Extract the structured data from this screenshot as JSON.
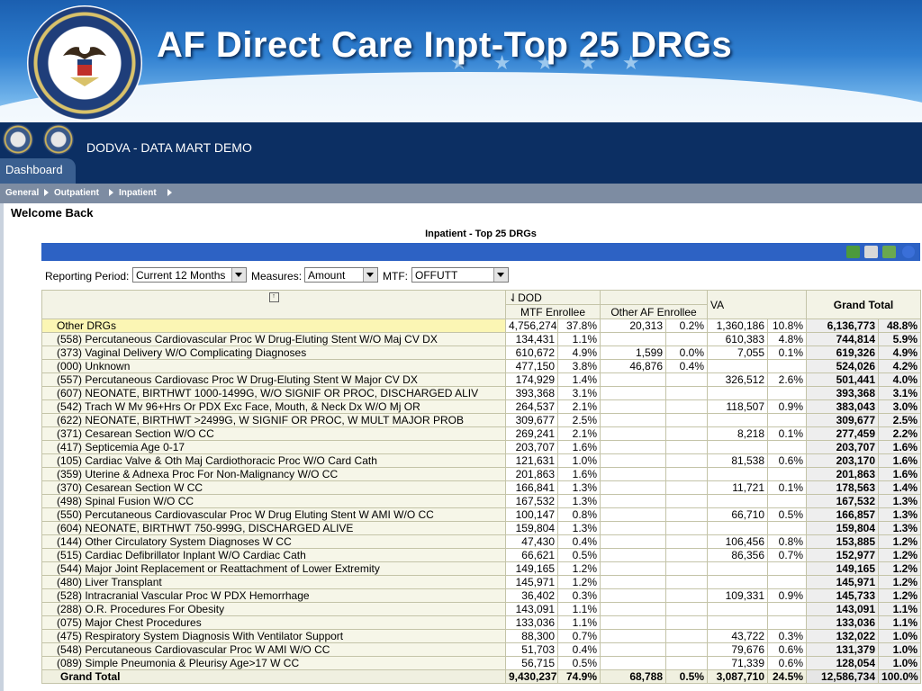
{
  "page_title": "AF Direct Care Inpt-Top 25 DRGs",
  "app": {
    "name": "DODVA - DATA MART DEMO",
    "tab": "Dashboard"
  },
  "subnav": [
    "General",
    "Outpatient",
    "Inpatient"
  ],
  "welcome": "Welcome Back",
  "report": {
    "title": "Inpatient - Top 25 DRGs",
    "params": {
      "period_label": "Reporting Period:",
      "period_value": "Current 12 Months",
      "measures_label": "Measures:",
      "measures_value": "Amount",
      "mtf_label": "MTF:",
      "mtf_value": "OFFUTT"
    },
    "headers": {
      "dod": "DOD",
      "mtf": "MTF Enrollee",
      "other_af": "Other AF Enrollee",
      "va": "VA",
      "grand_total": "Grand Total"
    },
    "rows": [
      [
        "Other DRGs",
        "4,756,274",
        "37.8%",
        "20,313",
        "0.2%",
        "1,360,186",
        "10.8%",
        "6,136,773",
        "48.8%"
      ],
      [
        "(558) Percutaneous Cardiovascular Proc W Drug-Eluting Stent W/O Maj CV DX",
        "134,431",
        "1.1%",
        "",
        "",
        "610,383",
        "4.8%",
        "744,814",
        "5.9%"
      ],
      [
        "(373) Vaginal Delivery W/O Complicating Diagnoses",
        "610,672",
        "4.9%",
        "1,599",
        "0.0%",
        "7,055",
        "0.1%",
        "619,326",
        "4.9%"
      ],
      [
        "(000) Unknown",
        "477,150",
        "3.8%",
        "46,876",
        "0.4%",
        "",
        "",
        "524,026",
        "4.2%"
      ],
      [
        "(557) Percutaneous Cardiovasc Proc W Drug-Eluting Stent W Major CV DX",
        "174,929",
        "1.4%",
        "",
        "",
        "326,512",
        "2.6%",
        "501,441",
        "4.0%"
      ],
      [
        "(607) NEONATE, BIRTHWT 1000-1499G, W/O SIGNIF OR PROC, DISCHARGED ALIV",
        "393,368",
        "3.1%",
        "",
        "",
        "",
        "",
        "393,368",
        "3.1%"
      ],
      [
        "(542) Trach W Mv 96+Hrs Or PDX Exc Face, Mouth, & Neck Dx W/O Mj OR",
        "264,537",
        "2.1%",
        "",
        "",
        "118,507",
        "0.9%",
        "383,043",
        "3.0%"
      ],
      [
        "(622) NEONATE, BIRTHWT >2499G, W SIGNIF OR PROC, W MULT MAJOR PROB",
        "309,677",
        "2.5%",
        "",
        "",
        "",
        "",
        "309,677",
        "2.5%"
      ],
      [
        "(371) Cesarean Section W/O CC",
        "269,241",
        "2.1%",
        "",
        "",
        "8,218",
        "0.1%",
        "277,459",
        "2.2%"
      ],
      [
        "(417) Septicemia Age 0-17",
        "203,707",
        "1.6%",
        "",
        "",
        "",
        "",
        "203,707",
        "1.6%"
      ],
      [
        "(105) Cardiac Valve & Oth Maj Cardiothoracic Proc W/O Card Cath",
        "121,631",
        "1.0%",
        "",
        "",
        "81,538",
        "0.6%",
        "203,170",
        "1.6%"
      ],
      [
        "(359) Uterine & Adnexa Proc For Non-Malignancy W/O CC",
        "201,863",
        "1.6%",
        "",
        "",
        "",
        "",
        "201,863",
        "1.6%"
      ],
      [
        "(370) Cesarean Section W CC",
        "166,841",
        "1.3%",
        "",
        "",
        "11,721",
        "0.1%",
        "178,563",
        "1.4%"
      ],
      [
        "(498) Spinal Fusion W/O CC",
        "167,532",
        "1.3%",
        "",
        "",
        "",
        "",
        "167,532",
        "1.3%"
      ],
      [
        "(550) Percutaneous Cardiovascular Proc W Drug Eluting Stent W AMI W/O CC",
        "100,147",
        "0.8%",
        "",
        "",
        "66,710",
        "0.5%",
        "166,857",
        "1.3%"
      ],
      [
        "(604) NEONATE, BIRTHWT 750-999G, DISCHARGED ALIVE",
        "159,804",
        "1.3%",
        "",
        "",
        "",
        "",
        "159,804",
        "1.3%"
      ],
      [
        "(144) Other Circulatory System Diagnoses W CC",
        "47,430",
        "0.4%",
        "",
        "",
        "106,456",
        "0.8%",
        "153,885",
        "1.2%"
      ],
      [
        "(515) Cardiac Defibrillator Inplant W/O Cardiac Cath",
        "66,621",
        "0.5%",
        "",
        "",
        "86,356",
        "0.7%",
        "152,977",
        "1.2%"
      ],
      [
        "(544) Major Joint Replacement or Reattachment of Lower Extremity",
        "149,165",
        "1.2%",
        "",
        "",
        "",
        "",
        "149,165",
        "1.2%"
      ],
      [
        "(480) Liver Transplant",
        "145,971",
        "1.2%",
        "",
        "",
        "",
        "",
        "145,971",
        "1.2%"
      ],
      [
        "(528) Intracranial Vascular Proc W PDX Hemorrhage",
        "36,402",
        "0.3%",
        "",
        "",
        "109,331",
        "0.9%",
        "145,733",
        "1.2%"
      ],
      [
        "(288) O.R. Procedures For Obesity",
        "143,091",
        "1.1%",
        "",
        "",
        "",
        "",
        "143,091",
        "1.1%"
      ],
      [
        "(075) Major Chest Procedures",
        "133,036",
        "1.1%",
        "",
        "",
        "",
        "",
        "133,036",
        "1.1%"
      ],
      [
        "(475) Respiratory System Diagnosis With Ventilator Support",
        "88,300",
        "0.7%",
        "",
        "",
        "43,722",
        "0.3%",
        "132,022",
        "1.0%"
      ],
      [
        "(548) Percutaneous Cardiovascular Proc W AMI W/O CC",
        "51,703",
        "0.4%",
        "",
        "",
        "79,676",
        "0.6%",
        "131,379",
        "1.0%"
      ],
      [
        "(089) Simple Pneumonia & Pleurisy Age>17 W CC",
        "56,715",
        "0.5%",
        "",
        "",
        "71,339",
        "0.6%",
        "128,054",
        "1.0%"
      ]
    ],
    "total": [
      "Grand Total",
      "9,430,237",
      "74.9%",
      "68,788",
      "0.5%",
      "3,087,710",
      "24.5%",
      "12,586,734",
      "100.0%"
    ]
  },
  "colors": {
    "accent": "#2d62c4",
    "appbar": "#0c2f63",
    "highlight_row": "#fbf6b4"
  }
}
